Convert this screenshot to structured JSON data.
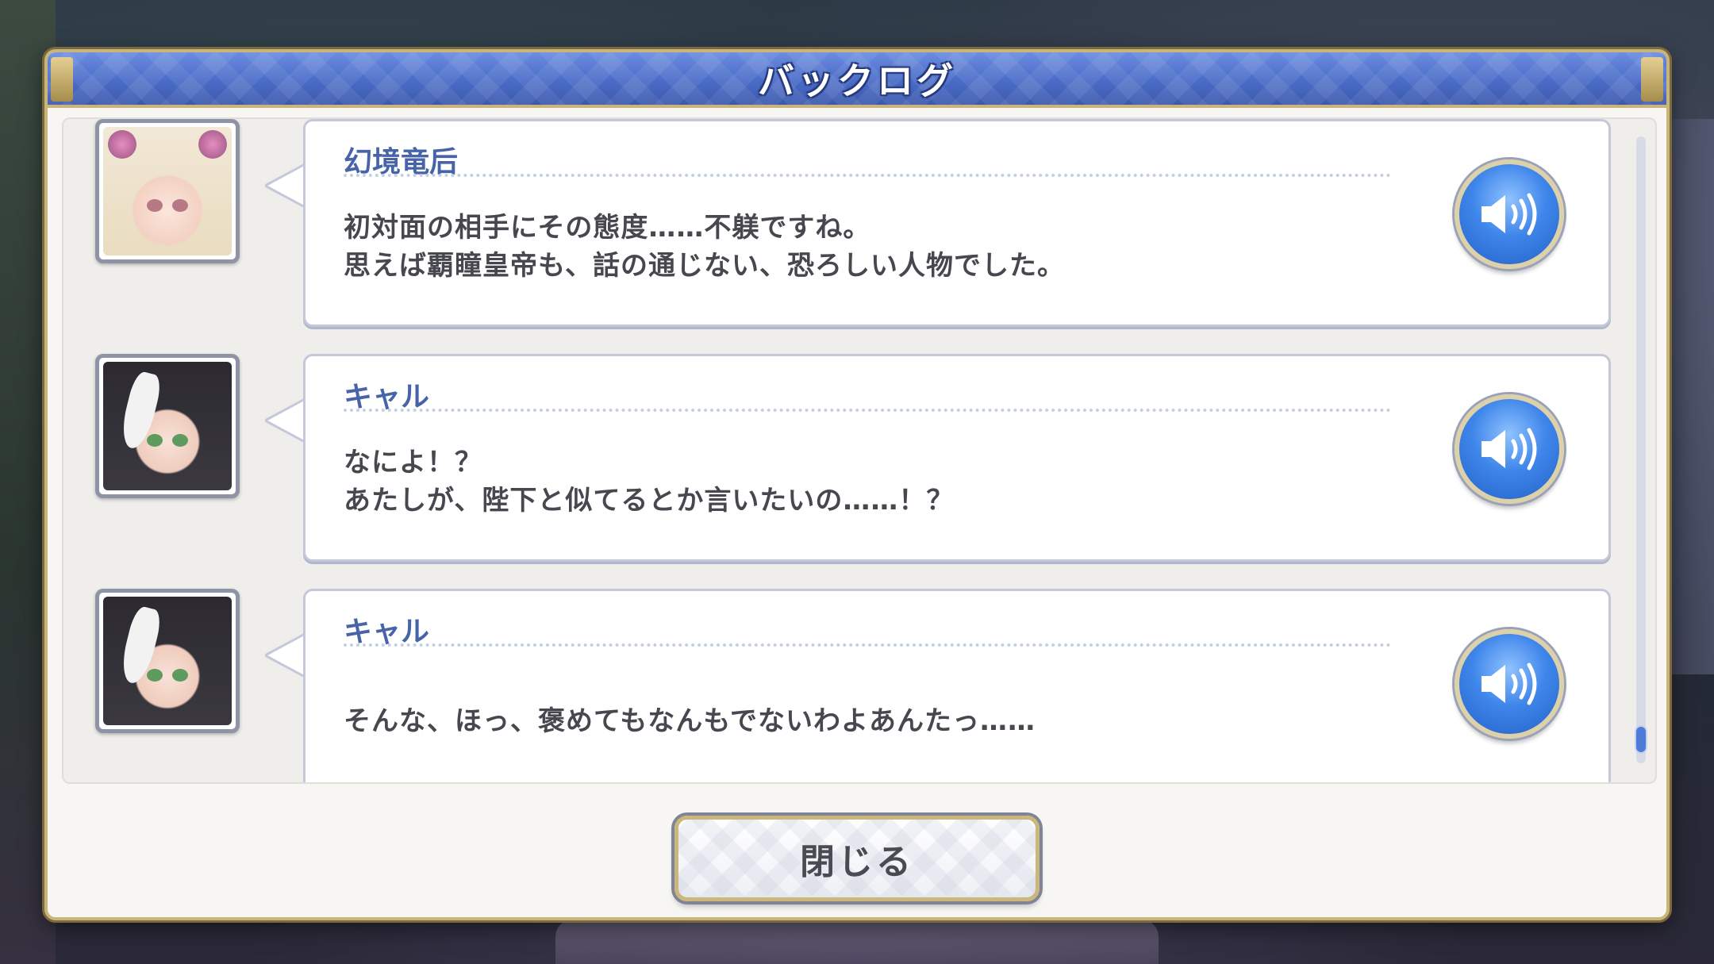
{
  "header": {
    "title": "バックログ"
  },
  "entries": [
    {
      "speaker": "幻境竜后",
      "avatar_icon": "dragon-queen-portrait",
      "lines": [
        "初対面の相手にその態度……不躾ですね。",
        "思えば覇瞳皇帝も、話の通じない、恐ろしい人物でした。"
      ]
    },
    {
      "speaker": "キャル",
      "avatar_icon": "karyl-portrait",
      "lines": [
        "なによ！？",
        "あたしが、陛下と似てるとか言いたいの……！？"
      ]
    },
    {
      "speaker": "キャル",
      "avatar_icon": "karyl-portrait",
      "lines": [
        "そんな、ほっ、褒めてもなんもでないわよあんたっ……"
      ]
    }
  ],
  "voice_icon": "speaker-volume-icon",
  "footer": {
    "close_label": "閉じる"
  },
  "colors": {
    "header_blue": "#4a6cc7",
    "speaker_name": "#4864a8",
    "gold_border": "#c9b47a",
    "voice_button": "#3f86ea"
  },
  "scroll_position": 1.0
}
